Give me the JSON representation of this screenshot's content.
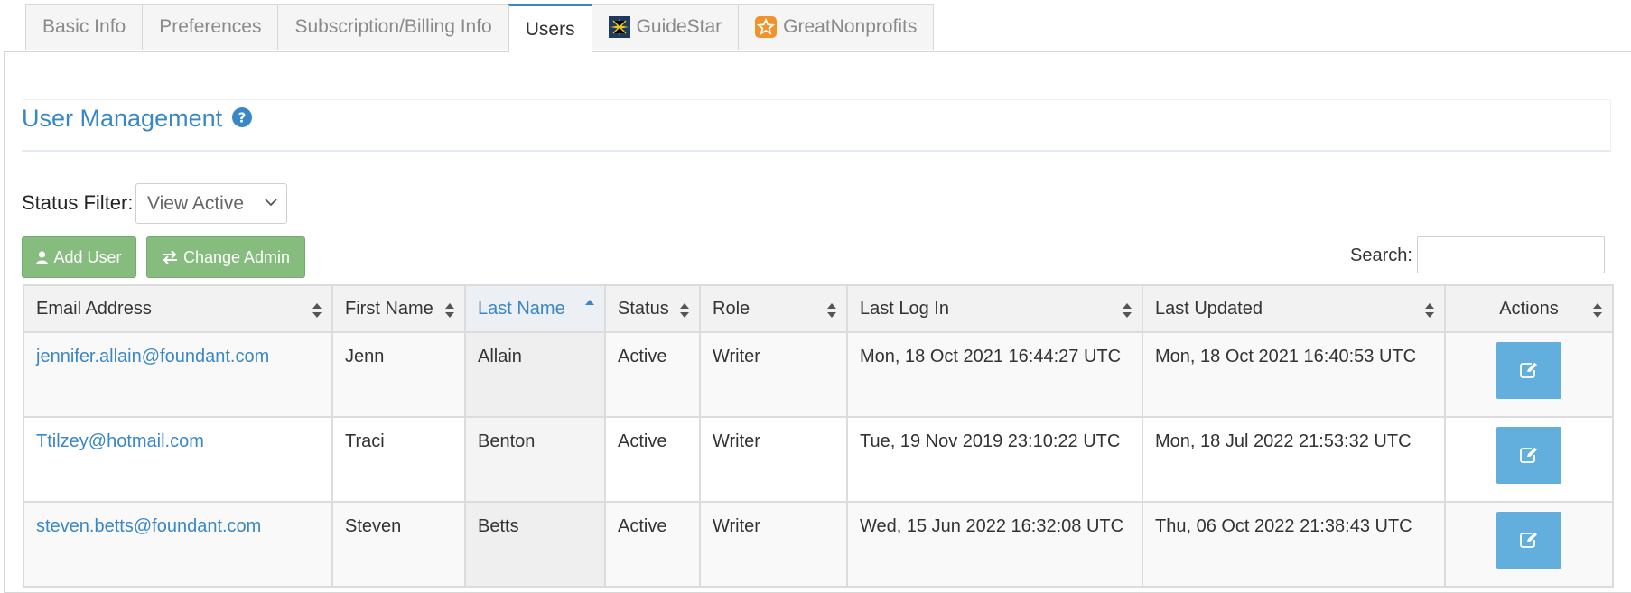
{
  "tabs": [
    {
      "label": "Basic Info"
    },
    {
      "label": "Preferences"
    },
    {
      "label": "Subscription/Billing Info"
    },
    {
      "label": "Users"
    },
    {
      "label": "GuideStar",
      "icon": "guidestar-icon"
    },
    {
      "label": "GreatNonprofits",
      "icon": "greatnonprofits-icon"
    }
  ],
  "header": {
    "title": "User Management",
    "help_icon": "question-circle-icon"
  },
  "filter": {
    "label": "Status Filter:",
    "selected": "View Active"
  },
  "toolbar": {
    "add_user_label": "Add User",
    "change_admin_label": "Change Admin",
    "search_label": "Search:",
    "search_value": ""
  },
  "table": {
    "columns": [
      "Email Address",
      "First Name",
      "Last Name",
      "Status",
      "Role",
      "Last Log In",
      "Last Updated",
      "Actions"
    ],
    "sorted_column": "Last Name",
    "rows": [
      {
        "email": "jennifer.allain@foundant.com",
        "first": "Jenn",
        "last": "Allain",
        "status": "Active",
        "role": "Writer",
        "last_login": "Mon, 18 Oct 2021 16:44:27 UTC",
        "last_updated": "Mon, 18 Oct 2021 16:40:53 UTC"
      },
      {
        "email": "Ttilzey@hotmail.com",
        "first": "Traci",
        "last": "Benton",
        "status": "Active",
        "role": "Writer",
        "last_login": "Tue, 19 Nov 2019 23:10:22 UTC",
        "last_updated": "Mon, 18 Jul 2022 21:53:32 UTC"
      },
      {
        "email": "steven.betts@foundant.com",
        "first": "Steven",
        "last": "Betts",
        "status": "Active",
        "role": "Writer",
        "last_login": "Wed, 15 Jun 2022 16:32:08 UTC",
        "last_updated": "Thu, 06 Oct 2022 21:38:43 UTC"
      }
    ]
  },
  "colors": {
    "accent": "#3a87c7",
    "button_green": "#86bd7f",
    "edit_button": "#62aedc"
  }
}
